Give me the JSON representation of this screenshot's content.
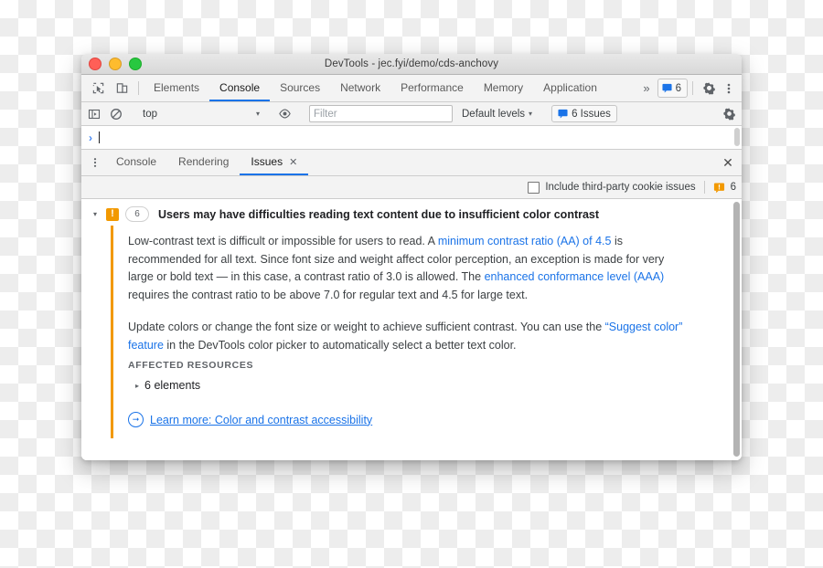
{
  "window": {
    "title": "DevTools - jec.fyi/demo/cds-anchovy",
    "traffic_lights": [
      "close",
      "minimize",
      "zoom"
    ]
  },
  "main_tabs": {
    "inspect_icon": "inspect-cursor-icon",
    "device_icon": "device-toolbar-icon",
    "items": [
      {
        "label": "Elements",
        "active": false
      },
      {
        "label": "Console",
        "active": true
      },
      {
        "label": "Sources",
        "active": false
      },
      {
        "label": "Network",
        "active": false
      },
      {
        "label": "Performance",
        "active": false
      },
      {
        "label": "Memory",
        "active": false
      },
      {
        "label": "Application",
        "active": false
      }
    ],
    "overflow": "»",
    "issue_chip": {
      "icon": "issue-flag-icon",
      "count": "6"
    },
    "settings_icon": "gear-icon",
    "more_icon": "kebab-menu-icon"
  },
  "console_toolbar": {
    "sidebar_icon": "console-sidebar-icon",
    "clear_icon": "clear-console-icon",
    "context": {
      "value": "top",
      "caret": "▾"
    },
    "eye_icon": "live-expression-eye-icon",
    "filter": {
      "placeholder": "Filter",
      "value": ""
    },
    "levels": {
      "label": "Default levels",
      "caret": "▾"
    },
    "issues_chip": {
      "icon": "issue-flag-icon",
      "label": "6 Issues"
    },
    "settings_icon": "gear-icon"
  },
  "prompt": {
    "arrow": "›",
    "value": ""
  },
  "drawer": {
    "more_icon": "kebab-menu-icon",
    "tabs": [
      {
        "label": "Console",
        "active": false,
        "closable": false
      },
      {
        "label": "Rendering",
        "active": false,
        "closable": false
      },
      {
        "label": "Issues",
        "active": true,
        "closable": true,
        "close_glyph": "✕"
      }
    ],
    "close_glyph": "✕"
  },
  "issues_bar": {
    "cookie_checkbox": {
      "label": "Include third-party cookie issues",
      "checked": false
    },
    "warning_icon": "warning-triangle-icon",
    "warning_count": "6"
  },
  "issue": {
    "twisty": "▾",
    "severity_icon": "warning-exclamation-icon",
    "severity_glyph": "!",
    "count": "6",
    "title": "Users may have difficulties reading text content due to insufficient color contrast",
    "paragraph_1": {
      "part_1": "Low-contrast text is difficult or impossible for users to read. A ",
      "link_1": "minimum contrast ratio (AA) of 4.5",
      "part_2": " is recommended for all text. Since font size and weight affect color perception, an exception is made for very large or bold text — in this case, a contrast ratio of 3.0 is allowed. The ",
      "link_2": "enhanced conformance level (AAA)",
      "part_3": " requires the contrast ratio to be above 7.0 for regular text and 4.5 for large text."
    },
    "paragraph_2": {
      "part_1": "Update colors or change the font size or weight to achieve sufficient contrast. You can use the ",
      "link_1": "“Suggest color” feature",
      "part_2": " in the DevTools color picker to automatically select a better text color."
    },
    "affected_resources_label": "AFFECTED RESOURCES",
    "affected_twisty": "▸",
    "affected_resource": "6 elements",
    "learn_more": {
      "icon": "arrow-right-circle-icon",
      "label": "Learn more: Color and contrast accessibility"
    }
  },
  "colors": {
    "accent_blue": "#1a73e8",
    "link_blue": "#1a73e8",
    "warning_orange": "#f29900",
    "toolbar_bg": "#f3f3f3",
    "border": "#cdcdcd"
  }
}
